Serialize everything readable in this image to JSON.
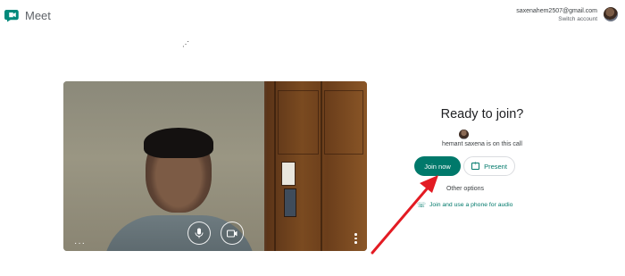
{
  "header": {
    "app_title": "Meet",
    "account_email": "saxenahem2507@gmail.com",
    "switch_account_label": "Switch account"
  },
  "icons": {
    "logo": "google-meet-logo",
    "mic": "microphone-icon",
    "camera": "camera-icon",
    "present": "present-screen-icon",
    "phone": "phone-icon"
  },
  "join_panel": {
    "heading": "Ready to join?",
    "participant_status": "hemant saxena is on this call",
    "join_button": "Join now",
    "present_button": "Present",
    "other_options": "Other options",
    "phone_link": "Join and use a phone for audio"
  },
  "colors": {
    "accent": "#00796b",
    "annotation_arrow": "#e31b23"
  }
}
